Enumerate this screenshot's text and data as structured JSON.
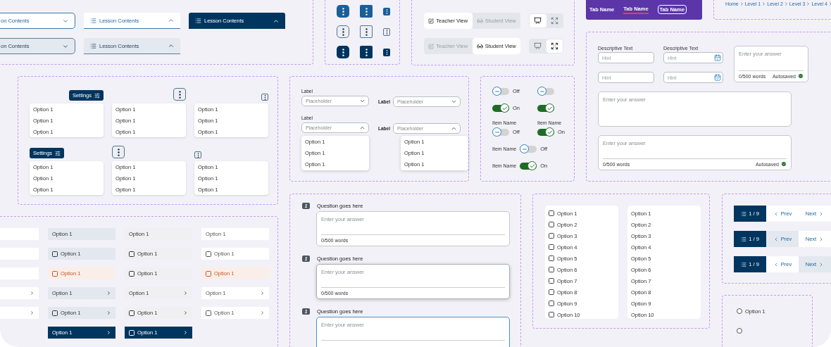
{
  "accordions": [
    {
      "label": "on Contents",
      "kind": "outline",
      "expanded": false
    },
    {
      "label": "Lesson Contents",
      "kind": "underline",
      "expanded": true
    },
    {
      "label": "Lesson Contents",
      "kind": "filled",
      "expanded": true
    },
    {
      "label": "on Contents",
      "kind": "outline-muted",
      "expanded": false
    },
    {
      "label": "Lesson Contents",
      "kind": "underline-muted",
      "expanded": true
    }
  ],
  "kebab_rows": [
    {
      "kind": "blue"
    },
    {
      "kind": "outline"
    },
    {
      "kind": "navy"
    }
  ],
  "view_toggles": [
    {
      "options": [
        {
          "label": "Teacher View",
          "selected": true
        },
        {
          "label": "Student View",
          "selected": false
        }
      ],
      "icons": [
        {
          "selected": true
        },
        {
          "selected": false
        }
      ]
    },
    {
      "options": [
        {
          "label": "Teacher View",
          "selected": false
        },
        {
          "label": "Student View",
          "selected": true
        }
      ],
      "icons": [
        {
          "selected": false
        },
        {
          "selected": true
        }
      ]
    }
  ],
  "tab_bar": {
    "tabs": [
      {
        "label": "Tab Name",
        "kind": "plain"
      },
      {
        "label": "Tab Name",
        "kind": "underlined"
      },
      {
        "label": "Tab Name",
        "kind": "outlined"
      }
    ]
  },
  "breadcrumb": {
    "items": [
      "Home",
      "Level 1",
      "Level 2",
      "Level 3",
      "Level 4"
    ]
  },
  "menus": [
    {
      "kind": "settings",
      "trigger_label": "Settings",
      "options": [
        "Option 1",
        "Option 1",
        "Option 1"
      ]
    },
    {
      "kind": "kebab",
      "options": [
        "Option 1",
        "Option 1",
        "Option 1"
      ]
    },
    {
      "kind": "kebab-small",
      "options": [
        "Option 1",
        "Option 1",
        "Option 1"
      ]
    },
    {
      "kind": "settings",
      "trigger_label": "Settings",
      "options": [
        "Option 1",
        "Option 1",
        "Option 1"
      ]
    },
    {
      "kind": "kebab",
      "options": [
        "Option 1",
        "Option 1",
        "Option 1"
      ]
    },
    {
      "kind": "kebab-small",
      "options": [
        "Option 1",
        "Option 1",
        "Option 1"
      ]
    }
  ],
  "dropdowns": [
    {
      "label": "Label",
      "kind": "top",
      "placeholder": "Placeholder",
      "expanded": false
    },
    {
      "label": "Label",
      "kind": "inline",
      "placeholder": "Placeholder",
      "expanded": false
    },
    {
      "label": "Label",
      "kind": "top",
      "placeholder": "Placeholder",
      "expanded": true,
      "options": [
        "Option 1",
        "Option 1",
        "Option 1"
      ]
    },
    {
      "label": "Label",
      "kind": "inline",
      "placeholder": "Placeholder",
      "expanded": true,
      "options": [
        "Option 1",
        "Option 1",
        "Option 1"
      ]
    }
  ],
  "toggles": [
    {
      "kind": "plain",
      "on": false,
      "text": "Off"
    },
    {
      "kind": "plain",
      "on": false
    },
    {
      "kind": "plain",
      "on": true,
      "text": "On"
    },
    {
      "kind": "plain",
      "on": true
    },
    {
      "kind": "stacked",
      "name": "Item Name",
      "on": false,
      "text": "Off"
    },
    {
      "kind": "stacked",
      "name": "Item Name",
      "on": true,
      "text": "On"
    },
    {
      "kind": "inline",
      "name": "Item Name",
      "on": false,
      "text": "Off"
    },
    {
      "kind": "inline",
      "name": "Item Name",
      "on": true,
      "text": "On"
    }
  ],
  "text_fields": [
    {
      "label": "Descriptive Text",
      "placeholder": "Hint",
      "kind": "text"
    },
    {
      "label": "Descriptive Text",
      "placeholder": "Hint",
      "kind": "date"
    },
    {
      "placeholder": "Hint",
      "kind": "text"
    },
    {
      "placeholder": "Hint",
      "kind": "date"
    }
  ],
  "compact_answer": {
    "placeholder": "Enter your answer",
    "counter": "0/500 words",
    "status": "Autosaved"
  },
  "wide_answers": [
    {
      "placeholder": "Enter your answer"
    },
    {
      "placeholder": "Enter your answer",
      "counter": "0/500 words",
      "status": "Autosaved"
    }
  ],
  "list_columns": [
    {
      "items": [
        {
          "kind": "white",
          "arrow": false
        },
        {
          "kind": "white",
          "arrow": false
        },
        {
          "kind": "white",
          "arrow": false
        },
        {
          "kind": "white",
          "arrow": true
        },
        {
          "kind": "white",
          "arrow": true
        }
      ]
    },
    {
      "items": [
        {
          "kind": "tinted",
          "label": "Option 1",
          "arrow": false
        },
        {
          "kind": "tinted",
          "label": "Option 1",
          "checked": false,
          "arrow": false
        },
        {
          "kind": "error",
          "label": "Option 1",
          "checked": false,
          "arrow": false
        },
        {
          "kind": "tinted",
          "label": "Option 1",
          "arrow": true
        },
        {
          "kind": "tinted",
          "label": "Option 1",
          "checked": false,
          "arrow": true
        },
        {
          "kind": "active",
          "label": "Option 1",
          "arrow": true
        }
      ]
    },
    {
      "items": [
        {
          "kind": "muted",
          "label": "Option 1",
          "arrow": false
        },
        {
          "kind": "muted",
          "label": "Option 1",
          "checked": false,
          "arrow": false
        },
        {
          "kind": "muted",
          "label": "Option 1",
          "checked": false,
          "arrow": false
        },
        {
          "kind": "muted",
          "label": "Option 1",
          "arrow": true
        },
        {
          "kind": "muted",
          "label": "Option 1",
          "checked": false,
          "arrow": true
        },
        {
          "kind": "active",
          "label": "Option 1",
          "checked": false,
          "arrow": true
        }
      ]
    },
    {
      "items": [
        {
          "kind": "white",
          "label": "Option 1",
          "arrow": false
        },
        {
          "kind": "white",
          "label": "Option 1",
          "checked": false,
          "arrow": false
        },
        {
          "kind": "error",
          "label": "Option 1",
          "checked": false,
          "arrow": false
        },
        {
          "kind": "white",
          "label": "Option 1",
          "arrow": true
        },
        {
          "kind": "white",
          "label": "Option 1",
          "checked": false,
          "arrow": true
        }
      ]
    }
  ],
  "questions": [
    {
      "number": "1",
      "question": "Question goes here",
      "placeholder": "Enter your answer",
      "counter": "0/500 words",
      "hovered": false,
      "focused": false
    },
    {
      "number": "1",
      "question": "Question goes here",
      "placeholder": "Enter your answer",
      "counter": "0/500 words",
      "hovered": true,
      "focused": false
    },
    {
      "number": "1",
      "question": "Question goes here",
      "placeholder": "Enter your answer",
      "hovered": false,
      "focused": true
    }
  ],
  "checklists": [
    {
      "kind": "checkbox",
      "options": [
        {
          "label": "Option 1",
          "checked": false
        },
        {
          "label": "Option 2",
          "checked": false
        },
        {
          "label": "Option 3",
          "checked": false
        },
        {
          "label": "Option 4",
          "checked": false
        },
        {
          "label": "Option 5",
          "checked": false
        },
        {
          "label": "Option 6",
          "checked": false
        },
        {
          "label": "Option 7",
          "checked": false
        },
        {
          "label": "Option 8",
          "checked": false
        },
        {
          "label": "Option 9",
          "checked": false
        },
        {
          "label": "Option 10",
          "checked": false
        }
      ]
    },
    {
      "kind": "plain",
      "options": [
        {
          "label": "Option 1"
        },
        {
          "label": "Option 2"
        },
        {
          "label": "Option 3"
        },
        {
          "label": "Option 4"
        },
        {
          "label": "Option 5"
        },
        {
          "label": "Option 6"
        },
        {
          "label": "Option 7"
        },
        {
          "label": "Option 8"
        },
        {
          "label": "Option 9"
        },
        {
          "label": "Option 10"
        }
      ]
    }
  ],
  "paginators": [
    {
      "count": "1 / 9",
      "prev": {
        "label": "Prev",
        "hovered": false
      },
      "next": {
        "label": "Next",
        "hovered": false
      }
    },
    {
      "count": "1 / 9",
      "prev": {
        "label": "Prev",
        "hovered": true
      },
      "next": {
        "label": "Next",
        "hovered": false
      }
    },
    {
      "count": "1 / 9",
      "prev": {
        "label": "Prev",
        "hovered": false
      },
      "next": {
        "label": "Next",
        "hovered": true
      }
    }
  ],
  "radios": [
    {
      "label": "Option 1",
      "selected": false
    },
    {
      "selected": false
    }
  ]
}
